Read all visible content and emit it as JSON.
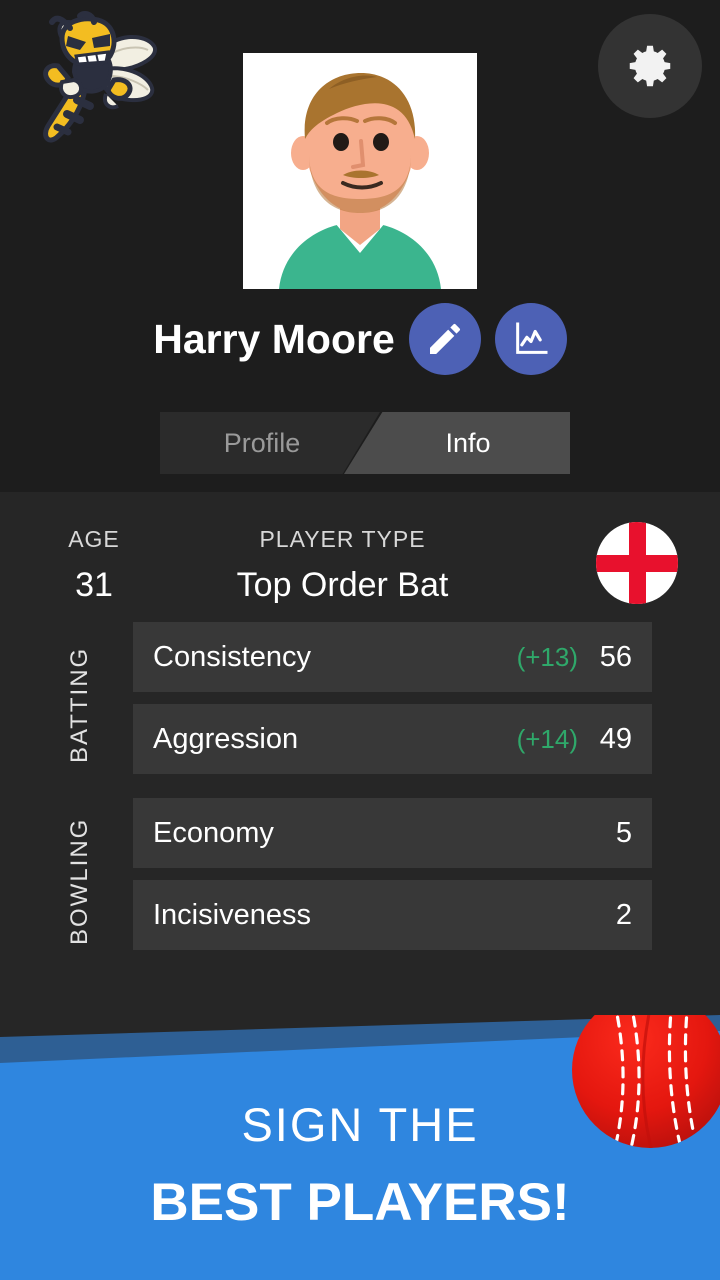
{
  "app": {
    "team_logo_icon": "hornet-mascot-logo",
    "settings_icon": "gear-icon"
  },
  "player": {
    "name": "Harry Moore",
    "avatar_icon": "player-avatar-photo",
    "edit_icon": "pencil-icon",
    "stats_icon": "line-chart-icon"
  },
  "tabs": [
    {
      "label": "Profile",
      "active": false
    },
    {
      "label": "Info",
      "active": true
    }
  ],
  "meta": {
    "age_label": "AGE",
    "age_value": "31",
    "type_label": "PLAYER TYPE",
    "type_value": "Top Order Bat",
    "nationality_icon": "england-flag-icon"
  },
  "groups": [
    {
      "label": "BATTING",
      "rows": [
        {
          "name": "Consistency",
          "delta": "(+13)",
          "value": "56"
        },
        {
          "name": "Aggression",
          "delta": "(+14)",
          "value": "49"
        }
      ]
    },
    {
      "label": "BOWLING",
      "rows": [
        {
          "name": "Economy",
          "delta": "",
          "value": "5"
        },
        {
          "name": "Incisiveness",
          "delta": "",
          "value": "2"
        }
      ]
    }
  ],
  "banner": {
    "line1": "SIGN THE",
    "line2": "BEST PLAYERS!",
    "ball_icon": "cricket-ball-icon",
    "bg_color": "#2f86df"
  },
  "colors": {
    "accent_blue": "#4d61b5",
    "positive_green": "#2fa86a",
    "header_bg": "#1d1d1d",
    "content_bg": "#262626",
    "row_bg": "#383838",
    "flag_red": "#e8112d"
  }
}
